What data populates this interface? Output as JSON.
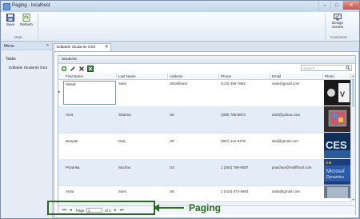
{
  "window": {
    "title": "Paging - localhost"
  },
  "ribbon": {
    "save_label": "Save",
    "refresh_label": "Refresh",
    "data_group_label": "Data",
    "design_label_1": "Design",
    "design_label_2": "Screen",
    "customize_group_label": "Customize"
  },
  "nav": {
    "header": "Menu",
    "category": "Tasks",
    "items": [
      {
        "label": "Editable Students Grid"
      }
    ]
  },
  "tab": {
    "label": "Editable Students Grid"
  },
  "grid": {
    "title": "Students",
    "search_placeholder": "Search",
    "columns": [
      "First Name",
      "Last Name",
      "Address",
      "Phone",
      "Email",
      "Photo"
    ],
    "rows": [
      {
        "first": "Vineet",
        "last": "Saini",
        "address": "Uttrakhand",
        "phone": "(123) 456-7893",
        "email": "saini@gmail.com",
        "photo": "apple-tv-image"
      },
      {
        "first": "Amit",
        "last": "Sharma",
        "address": "UK",
        "phone": "(458) 785-5874",
        "email": "amit@yahoo.com",
        "photo": "ipad-image"
      },
      {
        "first": "Deepak",
        "last": "Dwij",
        "address": "UP",
        "phone": "(857) 412-5478",
        "email": "dwij@gmail.com",
        "photo": "ces-image"
      },
      {
        "first": "Priyanka",
        "last": "Sachan",
        "address": "US",
        "phone": "1 (254) 789-6587",
        "email": "psachan@rediffmail.com",
        "photo": "microsoft-dynamics-image"
      },
      {
        "first": "Anita",
        "last": "Saini",
        "address": "UK",
        "phone": "2 (415) 874-5963",
        "email": "anita@gmail.com",
        "photo": "photo"
      }
    ]
  },
  "pager": {
    "page_label": "Page",
    "current_page": "1",
    "of_label": "of 2"
  },
  "annotation": {
    "label": "Paging",
    "color": "#2a6a1e"
  }
}
